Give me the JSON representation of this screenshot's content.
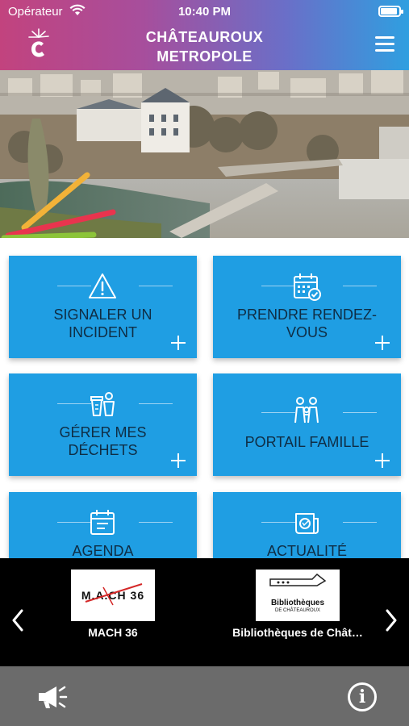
{
  "status_bar": {
    "carrier": "Opérateur",
    "time": "10:40 PM"
  },
  "header": {
    "title_line1": "CHÂTEAUROUX",
    "title_line2": "METROPOLE"
  },
  "tiles": [
    {
      "line1": "SIGNALER UN",
      "line2": "INCIDENT",
      "icon": "warning-icon"
    },
    {
      "line1": "PRENDRE RENDEZ-",
      "line2": "VOUS",
      "icon": "calendar-check-icon"
    },
    {
      "line1": "GÉRER MES",
      "line2": "DÉCHETS",
      "icon": "waste-bins-icon"
    },
    {
      "line1": "PORTAIL FAMILLE",
      "line2": "",
      "icon": "family-icon"
    },
    {
      "line1": "AGENDA",
      "line2": "",
      "icon": "agenda-icon"
    },
    {
      "line1": "ACTUALITÉ",
      "line2": "",
      "icon": "news-icon"
    }
  ],
  "carousel": {
    "items": [
      {
        "name": "MACH 36",
        "logo_text": "M.A.CH 36"
      },
      {
        "name": "Bibliothèques de Chât…",
        "logo_text": "Bibliothèques",
        "logo_subtext": "DE CHÂTEAUROUX"
      }
    ]
  },
  "colors": {
    "tile_blue": "#1f9ee3",
    "carousel_bg": "#000000",
    "bottom_bar": "#6b6b6b"
  }
}
